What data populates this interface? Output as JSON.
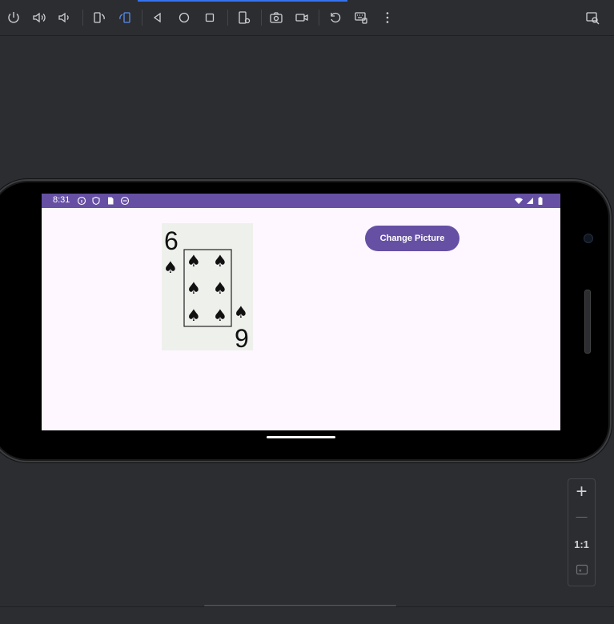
{
  "toolbar": {
    "icons": [
      "power-icon",
      "volume-up-icon",
      "volume-down-icon",
      "rotate-left-icon",
      "rotate-right-icon",
      "back-icon",
      "home-icon",
      "overview-icon",
      "device-settings-icon",
      "screenshot-icon",
      "screen-record-icon",
      "reset-icon",
      "keyboard-icon",
      "more-icon",
      "inspect-icon"
    ]
  },
  "device": {
    "status_time": "8:31",
    "button_label": "Change Picture",
    "card": {
      "rank": "6",
      "suit": "spades"
    }
  },
  "zoom": {
    "plus": "+",
    "minus": "—",
    "ratio": "1:1"
  },
  "colors": {
    "accent": "#6650a4",
    "screen_bg": "#fef7ff",
    "ide_bg": "#2b2d30"
  }
}
